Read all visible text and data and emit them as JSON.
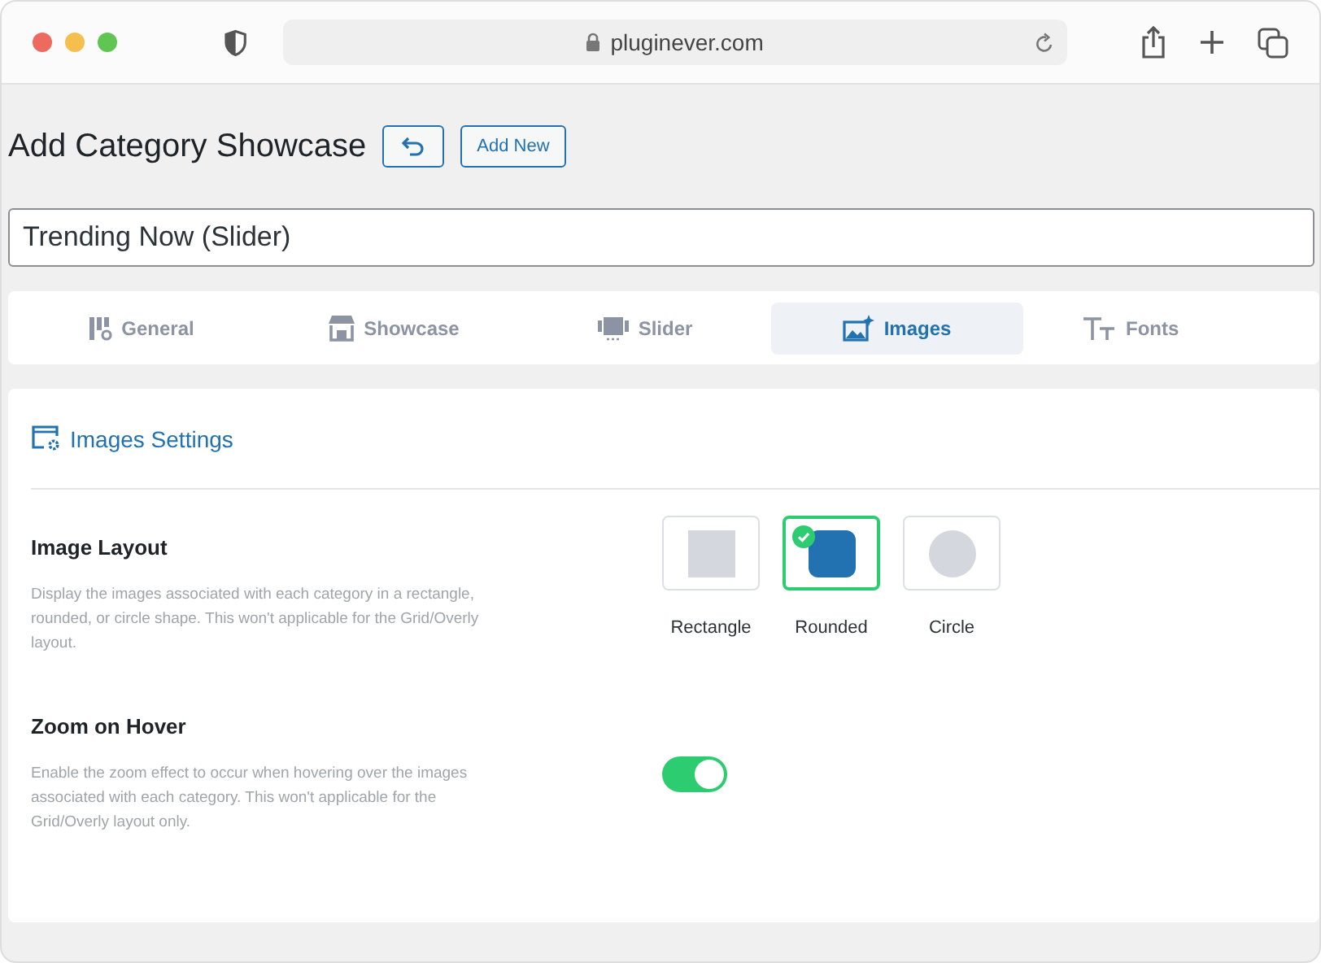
{
  "browser": {
    "url": "pluginever.com"
  },
  "page": {
    "title": "Add Category Showcase",
    "add_new": "Add New"
  },
  "name_field": {
    "value": "Trending Now (Slider)"
  },
  "tabs": [
    {
      "label": "General",
      "selected": false
    },
    {
      "label": "Showcase",
      "selected": false
    },
    {
      "label": "Slider",
      "selected": false
    },
    {
      "label": "Images",
      "selected": true
    },
    {
      "label": "Fonts",
      "selected": false
    }
  ],
  "section": {
    "title": "Images Settings"
  },
  "settings": [
    {
      "kind": "shapes",
      "label": "Image Layout",
      "description": "Display the images associated with each category in a rectangle, rounded, or circle shape. This won't applicable for the Grid/Overly layout.",
      "options": [
        {
          "kind": "rectangle",
          "label": "Rectangle",
          "selected": false
        },
        {
          "kind": "rounded",
          "label": "Rounded",
          "selected": true
        },
        {
          "kind": "circle",
          "label": "Circle",
          "selected": false
        }
      ]
    },
    {
      "kind": "toggle",
      "label": "Zoom on Hover",
      "description": "Enable the zoom effect to occur when hovering over the images associated with each category. This won't applicable for the Grid/Overly layout only.",
      "on": true
    }
  ]
}
